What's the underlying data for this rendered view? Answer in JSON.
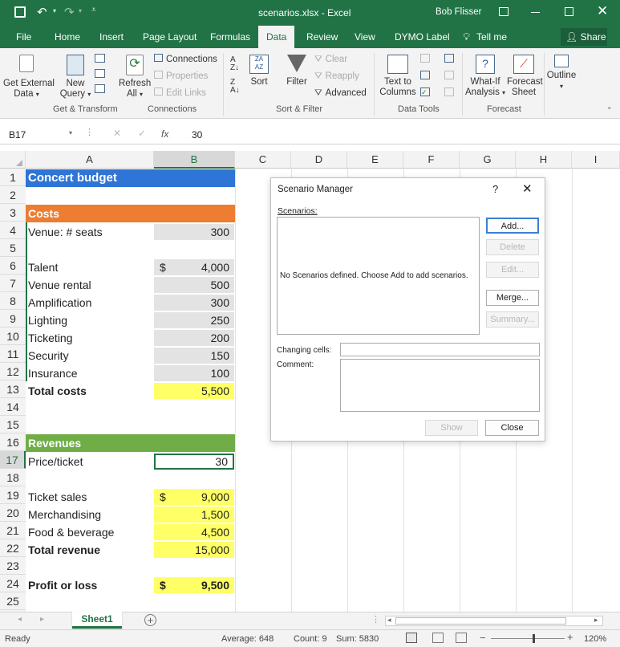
{
  "window": {
    "title": "scenarios.xlsx - Excel",
    "user": "Bob Flisser",
    "share": "Share"
  },
  "tabs": [
    "File",
    "Home",
    "Insert",
    "Page Layout",
    "Formulas",
    "Data",
    "Review",
    "View",
    "DYMO Label"
  ],
  "tell_me": "Tell me",
  "ribbon": {
    "get_external": [
      "Get External",
      "Data"
    ],
    "new_query": [
      "New",
      "Query"
    ],
    "refresh_all": [
      "Refresh",
      "All"
    ],
    "connections": "Connections",
    "properties": "Properties",
    "edit_links": "Edit Links",
    "sort": "Sort",
    "filter": "Filter",
    "clear": "Clear",
    "reapply": "Reapply",
    "advanced": "Advanced",
    "text_to_columns": [
      "Text to",
      "Columns"
    ],
    "what_if": [
      "What-If",
      "Analysis"
    ],
    "forecast_sheet": [
      "Forecast",
      "Sheet"
    ],
    "outline": "Outline",
    "groups": {
      "get_transform": "Get & Transform",
      "connections": "Connections",
      "sort_filter": "Sort & Filter",
      "data_tools": "Data Tools",
      "forecast": "Forecast"
    }
  },
  "formula_bar": {
    "name_box": "B17",
    "fx": "fx",
    "value": "30"
  },
  "columns": [
    "A",
    "B",
    "C",
    "D",
    "E",
    "F",
    "G",
    "H",
    "I"
  ],
  "rows": [
    "1",
    "2",
    "3",
    "4",
    "5",
    "6",
    "7",
    "8",
    "9",
    "10",
    "11",
    "12",
    "13",
    "14",
    "15",
    "16",
    "17",
    "18",
    "19",
    "20",
    "21",
    "22",
    "23",
    "24",
    "25"
  ],
  "sheet": {
    "title": "Concert budget",
    "costs_header": "Costs",
    "venue_seats": {
      "label": "Venue: # seats",
      "value": "300"
    },
    "talent": {
      "label": "Talent",
      "value": "4,000"
    },
    "venue_rental": {
      "label": "Venue rental",
      "value": "500"
    },
    "amplification": {
      "label": "Amplification",
      "value": "300"
    },
    "lighting": {
      "label": "Lighting",
      "value": "250"
    },
    "ticketing": {
      "label": "Ticketing",
      "value": "200"
    },
    "security": {
      "label": "Security",
      "value": "150"
    },
    "insurance": {
      "label": "Insurance",
      "value": "100"
    },
    "total_costs": {
      "label": "Total costs",
      "value": "5,500"
    },
    "revenues_header": "Revenues",
    "price_ticket": {
      "label": "Price/ticket",
      "value": "30"
    },
    "ticket_sales": {
      "label": "Ticket sales",
      "value": "9,000"
    },
    "merchandising": {
      "label": "Merchandising",
      "value": "1,500"
    },
    "food_beverage": {
      "label": "Food & beverage",
      "value": "4,500"
    },
    "total_revenue": {
      "label": "Total revenue",
      "value": "15,000"
    },
    "profit_loss": {
      "label": "Profit or loss",
      "value": "9,500"
    },
    "currency": "$"
  },
  "dialog": {
    "title": "Scenario Manager",
    "help": "?",
    "scenarios_label": "Scenarios:",
    "empty_message": "No Scenarios defined. Choose Add to add scenarios.",
    "add": "Add...",
    "delete": "Delete",
    "edit": "Edit...",
    "merge": "Merge...",
    "summary": "Summary...",
    "changing_cells": "Changing cells:",
    "comment": "Comment:",
    "show": "Show",
    "close": "Close"
  },
  "sheet_tab": "Sheet1",
  "status": {
    "ready": "Ready",
    "average": "Average: 648",
    "count": "Count: 9",
    "sum": "Sum: 5830",
    "zoom": "120%"
  },
  "colors": {
    "excel_green": "#217346",
    "title_blue": "#2e75d6",
    "orange": "#ed7d31",
    "green": "#70ad47",
    "yellow": "#ffff66",
    "input_grey": "#e3e3e3"
  }
}
